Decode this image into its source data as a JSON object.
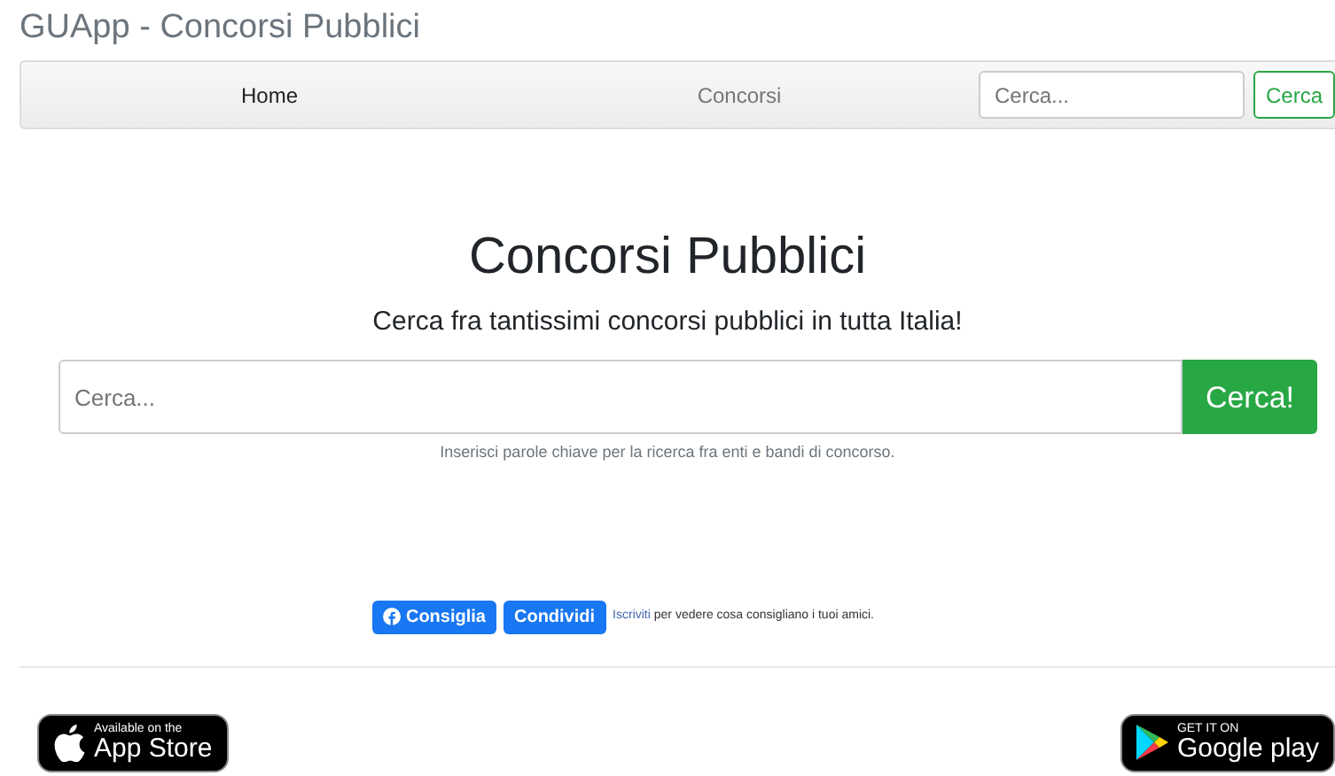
{
  "site_title": "GUApp - Concorsi Pubblici",
  "nav": {
    "items": [
      {
        "label": "Home",
        "selected": true
      },
      {
        "label": "Concorsi",
        "selected": false
      }
    ],
    "search_placeholder": "Cerca...",
    "search_button": "Cerca"
  },
  "hero": {
    "title": "Concorsi Pubblici",
    "subtitle": "Cerca fra tantissimi concorsi pubblici in tutta Italia!",
    "search_placeholder": "Cerca...",
    "search_button": "Cerca!",
    "help": "Inserisci parole chiave per la ricerca fra enti e bandi di concorso."
  },
  "social": {
    "like_button": "Consiglia",
    "share_button": "Condividi",
    "signup_link": "Iscriviti",
    "signup_text": "per vedere cosa consigliano i tuoi amici."
  },
  "stores": [
    {
      "kind": "apple",
      "small": "Available on the",
      "big": "App Store"
    },
    {
      "kind": "google",
      "small": "GET IT ON",
      "big": "Google play"
    }
  ]
}
